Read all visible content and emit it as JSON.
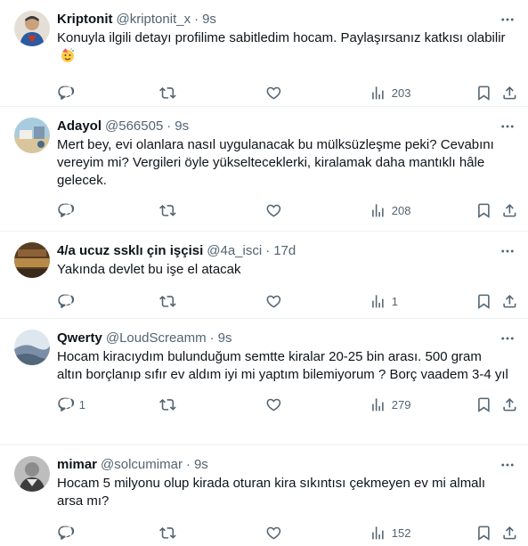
{
  "tweets": [
    {
      "name": "Kriptonit",
      "handle": "@kriptonit_x",
      "time": "9s",
      "text": "Konuyla ilgili detayı profilime sabitledim hocam. Paylaşırsanız katkısı olabilir",
      "has_emoji": true,
      "reply_count": "",
      "views": "203",
      "avatar_colors": [
        "#d7d2cc",
        "#c0392b",
        "#2c5aa0"
      ]
    },
    {
      "name": "Adayol",
      "handle": "@566505",
      "time": "9s",
      "text": "Mert bey, evi olanlara nasıl uygulanacak bu mülksüzleşme peki? Cevabını vereyim mi? Vergileri öyle yükselteceklerki, kiralamak daha mantıklı hâle gelecek.",
      "reply_count": "",
      "views": "208",
      "avatar_colors": [
        "#9fc3d8",
        "#d6c39a",
        "#6a8aa3"
      ]
    },
    {
      "name": "4/a ucuz ssklı çin işçisi",
      "handle": "@4a_isci",
      "time": "17d",
      "text": "Yakında devlet bu işe el atacak",
      "reply_count": "",
      "views": "1",
      "avatar_colors": [
        "#6b4a2a",
        "#b88a4a",
        "#3a2a1a"
      ]
    },
    {
      "name": "Qwerty",
      "handle": "@LoudScreamm",
      "time": "9s",
      "text": "Hocam kiracıydım bulunduğum semtte kiralar 20-25 bin arası. 500 gram altın borçlanıp sıfır ev aldım iyi mi yaptım bilemiyorum ? Borç vaadem 3-4 yıl",
      "reply_count": "1",
      "views": "279",
      "avatar_colors": [
        "#c9d6e3",
        "#7a8fa6",
        "#eef2f6"
      ]
    },
    {
      "name": "mimar",
      "handle": "@solcumimar",
      "time": "9s",
      "text": "Hocam 5 milyonu olup kirada oturan kira sıkıntısı çekmeyen ev mi almalı arsa mı?",
      "reply_count": "",
      "views": "152",
      "avatar_colors": [
        "#8c8c8c",
        "#3d3d3d",
        "#cfcfcf"
      ]
    }
  ],
  "icons": {
    "reply": "reply-icon",
    "retweet": "retweet-icon",
    "like": "like-icon",
    "views": "views-icon",
    "bookmark": "bookmark-icon",
    "share": "share-icon",
    "more": "more-icon"
  }
}
